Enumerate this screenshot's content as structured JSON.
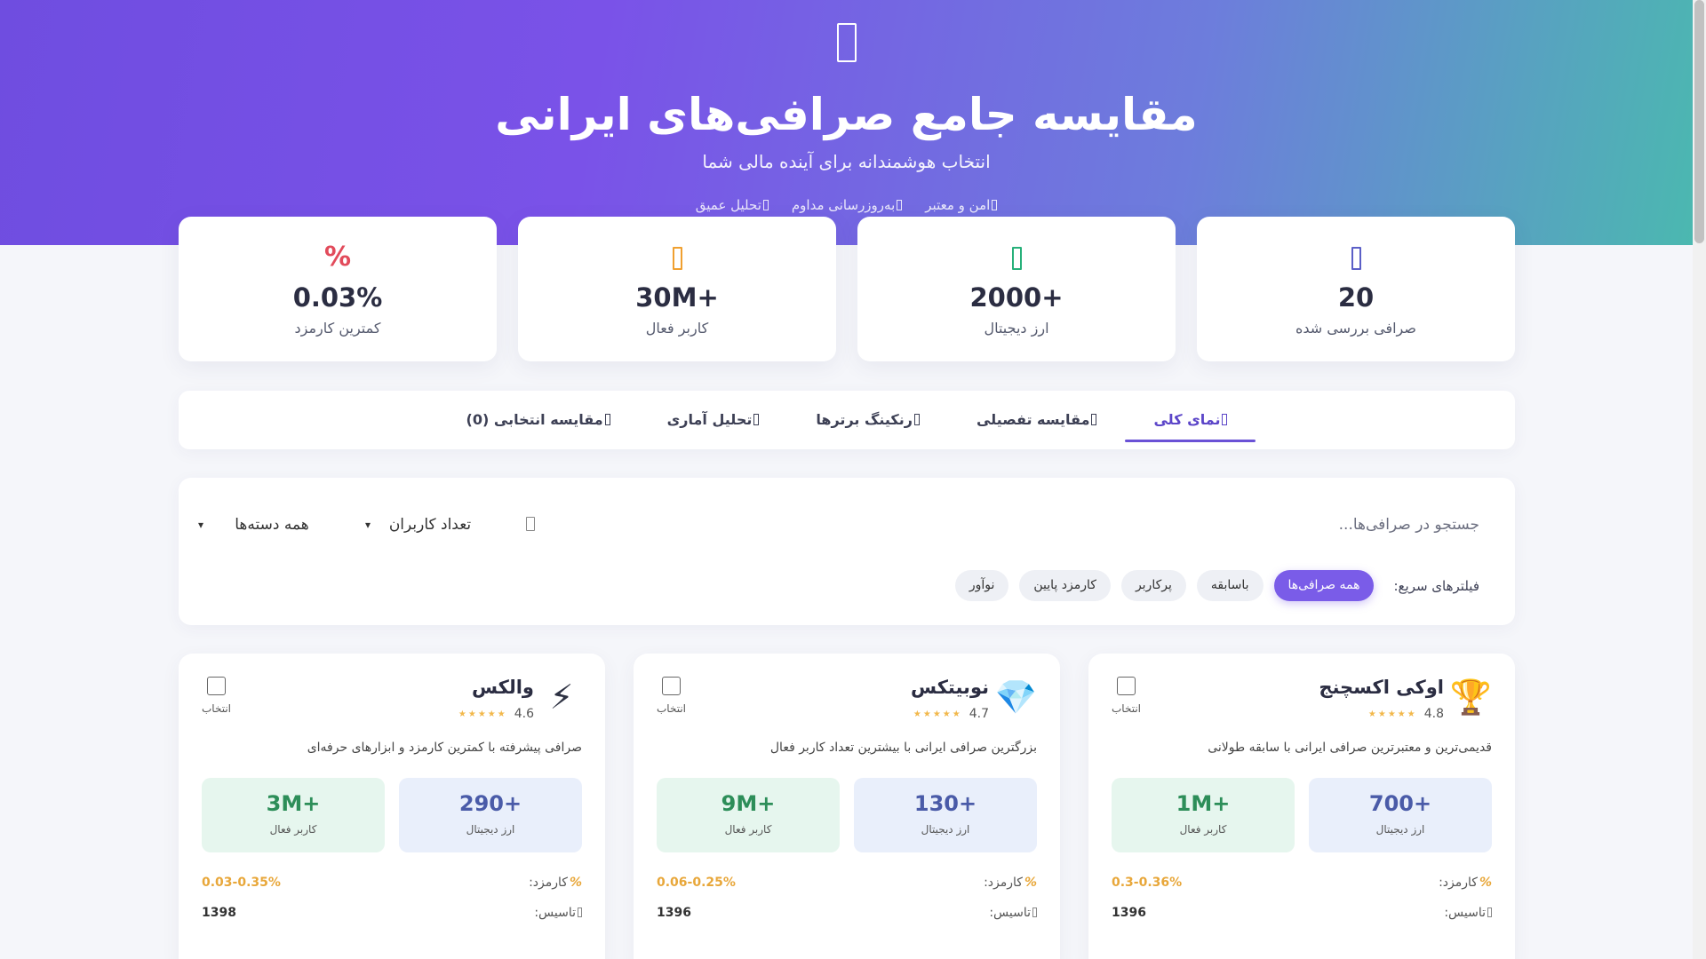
{
  "hero": {
    "title": "مقایسه جامع صرافی‌های ایرانی",
    "subtitle": "انتخاب هوشمندانه برای آینده مالی شما",
    "badges": [
      "امن و معتبر",
      "به‌روزرسانی مداوم",
      "تحلیل عمیق"
    ]
  },
  "stats": [
    {
      "icon": "box-icon",
      "value": "20",
      "label": "صرافی بررسی شده",
      "color": "#5b5fc7"
    },
    {
      "icon": "box-icon",
      "value": "2000+",
      "label": "ارز دیجیتال",
      "color": "#27b07a"
    },
    {
      "icon": "box-icon",
      "value": "30M+",
      "label": "کاربر فعال",
      "color": "#f0a030"
    },
    {
      "icon": "percent-icon",
      "value": "0.03%",
      "label": "کمترین کارمزد",
      "color": "#e24b5b",
      "symbol": "%"
    }
  ],
  "tabs": [
    {
      "label": "نمای کلی",
      "active": true
    },
    {
      "label": "مقایسه تفصیلی",
      "active": false
    },
    {
      "label": "رنکینگ برترها",
      "active": false
    },
    {
      "label": "تحلیل آماری",
      "active": false
    },
    {
      "label": "مقایسه انتخابی (0)",
      "active": false
    }
  ],
  "filters": {
    "search_placeholder": "جستجو در صرافی‌ها...",
    "sort_selected": "تعداد کاربران",
    "category_selected": "همه دسته‌ها",
    "quick_label": "فیلترهای سریع:",
    "chips": [
      {
        "label": "همه صرافی‌ها",
        "active": true
      },
      {
        "label": "باسابقه",
        "active": false
      },
      {
        "label": "پرکاربر",
        "active": false
      },
      {
        "label": "کارمزد پایین",
        "active": false
      },
      {
        "label": "نوآور",
        "active": false
      }
    ]
  },
  "cards": [
    {
      "emoji": "🏆",
      "name": "اوکی اکسچنج",
      "rating": "4.8",
      "select_label": "انتخاب",
      "desc": "قدیمی‌ترین و معتبرترین صرافی ایرانی با سابقه طولانی",
      "metric1_value": "700+",
      "metric1_label": "ارز دیجیتال",
      "metric2_value": "1M+",
      "metric2_label": "کاربر فعال",
      "fee_label": "کارمزد:",
      "fee_value": "0.3-0.36%",
      "founded_label": "تاسیس:",
      "founded_value": "1396"
    },
    {
      "emoji": "💎",
      "name": "نوبیتکس",
      "rating": "4.7",
      "select_label": "انتخاب",
      "desc": "بزرگترین صرافی ایرانی با بیشترین تعداد کاربر فعال",
      "metric1_value": "130+",
      "metric1_label": "ارز دیجیتال",
      "metric2_value": "9M+",
      "metric2_label": "کاربر فعال",
      "fee_label": "کارمزد:",
      "fee_value": "0.06-0.25%",
      "founded_label": "تاسیس:",
      "founded_value": "1396"
    },
    {
      "emoji": "⚡",
      "name": "والکس",
      "rating": "4.6",
      "select_label": "انتخاب",
      "desc": "صرافی پیشرفته با کمترین کارمزد و ابزارهای حرفه‌ای",
      "metric1_value": "290+",
      "metric1_label": "ارز دیجیتال",
      "metric2_value": "3M+",
      "metric2_label": "کاربر فعال",
      "fee_label": "کارمزد:",
      "fee_value": "0.03-0.35%",
      "founded_label": "تاسیس:",
      "founded_value": "1398"
    }
  ]
}
